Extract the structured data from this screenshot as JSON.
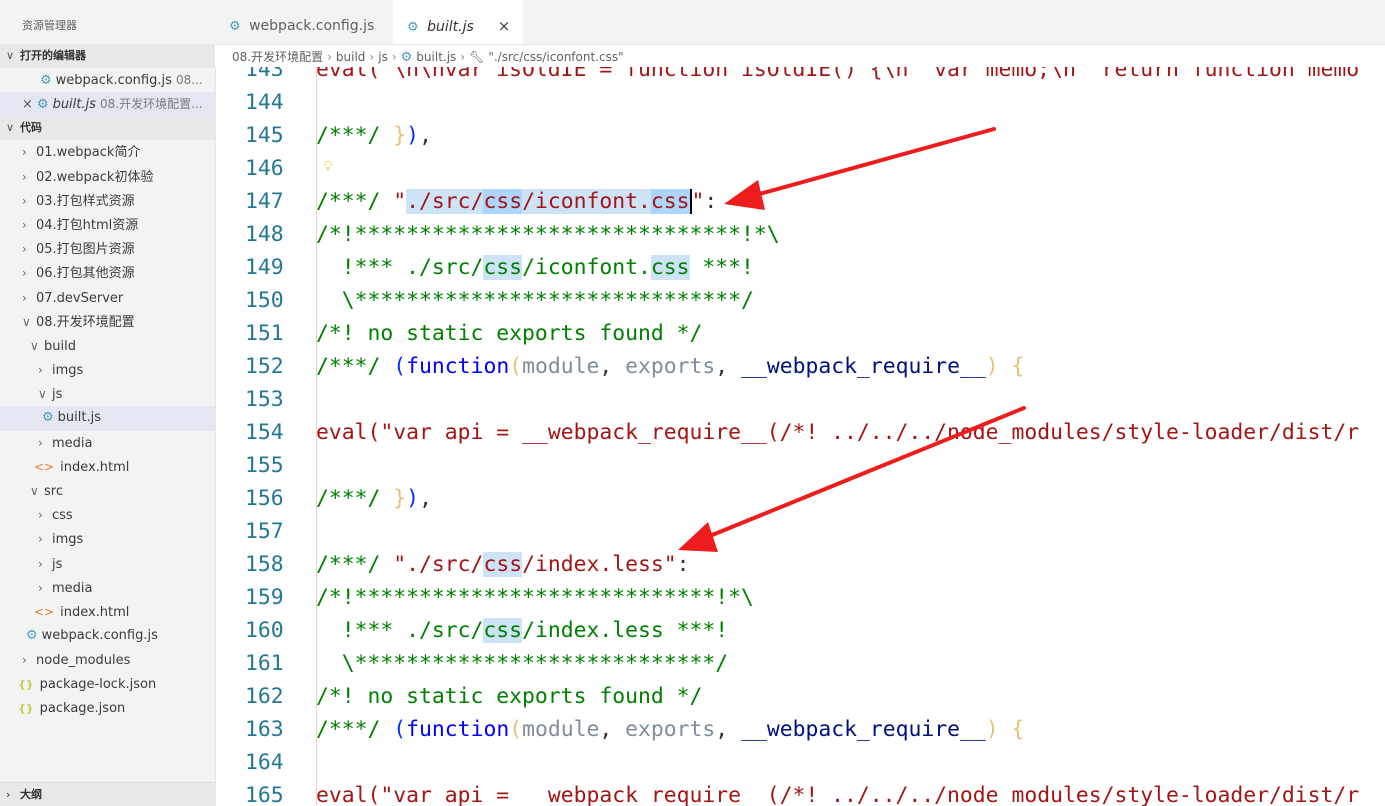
{
  "sidebar": {
    "title": "资源管理器",
    "open_editors_label": "打开的编辑器",
    "open_editors": [
      {
        "name": "webpack.config.js",
        "path": "08..."
      },
      {
        "name": "built.js",
        "path": "08.开发环境配置..."
      }
    ],
    "workspace_label": "代码",
    "tree": [
      "01.webpack简介",
      "02.webpack初体验",
      "03.打包样式资源",
      "04.打包html资源",
      "05.打包图片资源",
      "06.打包其他资源",
      "07.devServer",
      "08.开发环境配置",
      "build",
      "imgs",
      "js",
      "built.js",
      "media",
      "index.html",
      "src",
      "css",
      "imgs",
      "js",
      "media",
      "index.html",
      "webpack.config.js",
      "node_modules",
      "package-lock.json",
      "package.json"
    ],
    "outline_label": "大纲"
  },
  "tabs": [
    {
      "label": "webpack.config.js"
    },
    {
      "label": "built.js",
      "close": "×"
    }
  ],
  "breadcrumb": [
    "08.开发环境配置",
    "build",
    "js",
    "built.js",
    "\"./src/css/iconfont.css\""
  ],
  "code": {
    "l143": {
      "num": "143",
      "text": "eval(\"\\n\\nvar isOldIE = function isOldIE() {\\n  var memo;\\n  return function memo"
    },
    "l144": {
      "num": "144"
    },
    "l145": {
      "num": "145",
      "a": "/***/ ",
      "b": "}",
      "c": ")",
      "d": ","
    },
    "l146": {
      "num": "146"
    },
    "l147": {
      "num": "147",
      "a": "/***/ ",
      "q": "\"",
      "s1": "./src/",
      "s2": "css",
      "s3": "/iconfont.",
      "s4": "css",
      "q2": "\"",
      "colon": ":"
    },
    "l148": {
      "num": "148",
      "text": "/*!******************************!*\\"
    },
    "l149": {
      "num": "149",
      "a": "  !*** ./src/",
      "b": "css",
      "c": "/iconfont.",
      "d": "css",
      "e": " ***!"
    },
    "l150": {
      "num": "150",
      "text": "  \\******************************/"
    },
    "l151": {
      "num": "151",
      "text": "/*! no static exports found */"
    },
    "l152": {
      "num": "152",
      "a": "/***/ ",
      "p1": "(",
      "fn": "function",
      "p2": "(",
      "m": "module",
      "c1": ", ",
      "e": "exports",
      "c2": ", ",
      "r": "__webpack_require__",
      "p3": ") ",
      "br": "{"
    },
    "l153": {
      "num": "153"
    },
    "l154": {
      "num": "154",
      "a": "eval(",
      "s": "\"var api = __webpack_require__(/*! ../../../node_modules/style-loader/dist/r"
    },
    "l155": {
      "num": "155"
    },
    "l156": {
      "num": "156",
      "a": "/***/ ",
      "b": "}",
      "c": ")",
      "d": ","
    },
    "l157": {
      "num": "157"
    },
    "l158": {
      "num": "158",
      "a": "/***/ ",
      "s1": "\"./src/",
      "s2": "css",
      "s3": "/index.less\"",
      "colon": ":"
    },
    "l159": {
      "num": "159",
      "text": "/*!****************************!*\\"
    },
    "l160": {
      "num": "160",
      "a": "  !*** ./src/",
      "b": "css",
      "c": "/index.less ***!"
    },
    "l161": {
      "num": "161",
      "text": "  \\****************************/"
    },
    "l162": {
      "num": "162",
      "text": "/*! no static exports found */"
    },
    "l163": {
      "num": "163",
      "a": "/***/ ",
      "p1": "(",
      "fn": "function",
      "p2": "(",
      "m": "module",
      "c1": ", ",
      "e": "exports",
      "c2": ", ",
      "r": "__webpack_require__",
      "p3": ") ",
      "br": "{"
    },
    "l164": {
      "num": "164"
    },
    "l165": {
      "num": "165",
      "a": "eval(",
      "s": "\"var api = __webpack_require__(/*! ../../../node_modules/style-loader/dist/r"
    }
  },
  "colors": {
    "accent": "#0000ff",
    "string": "#a31515",
    "comment": "#008000",
    "arrow": "#ee1c1c"
  }
}
